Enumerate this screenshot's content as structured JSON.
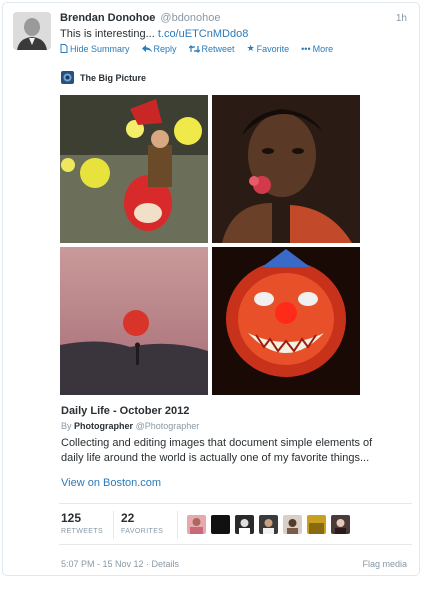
{
  "tweet": {
    "name": "Brendan Donohoe",
    "handle": "@bdonohoe",
    "time": "1h",
    "text": "This is interesting... ",
    "link": "t.co/uETCnMDdo8"
  },
  "actions": {
    "hide_summary": "Hide Summary",
    "reply": "Reply",
    "retweet": "Retweet",
    "favorite": "Favorite",
    "more": "More"
  },
  "icons": {
    "summary": "document-icon",
    "reply": "reply-arrow-icon",
    "retweet": "retweet-icon",
    "favorite": "star-icon",
    "more": "ellipsis-icon",
    "source": "big-picture-logo-icon"
  },
  "card": {
    "source_name": "The Big Picture",
    "title": "Daily Life - October 2012",
    "by_prefix": "By",
    "by_name": "Photographer",
    "by_handle": "@Photographer",
    "description": "Collecting and editing images that document simple elements of daily life around the world is actually one of my favorite things...",
    "view_link": "View on Boston.com"
  },
  "stats": {
    "retweets_count": "125",
    "retweets_label": "RETWEETS",
    "favorites_count": "22",
    "favorites_label": "FAVORITES"
  },
  "footer": {
    "timestamp": "5:07 PM - 15 Nov 12",
    "separator": " · ",
    "details": "Details",
    "flag": "Flag media"
  },
  "colors": {
    "link": "#2b7bb9",
    "muted": "#8899a6",
    "text": "#292f33",
    "border": "#e1e8ed"
  }
}
